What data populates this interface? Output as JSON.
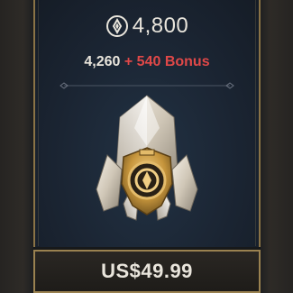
{
  "offer": {
    "currency_icon": "rp-coin-icon",
    "amount": "4,800",
    "base_amount": "4,260",
    "bonus_text": "+ 540 Bonus",
    "price": "US$49.99",
    "image": "crystal-currency-bundle-icon"
  },
  "colors": {
    "bonus": "#e04848",
    "border_gold": "#9a8250",
    "card_bg": "#1b2533"
  }
}
